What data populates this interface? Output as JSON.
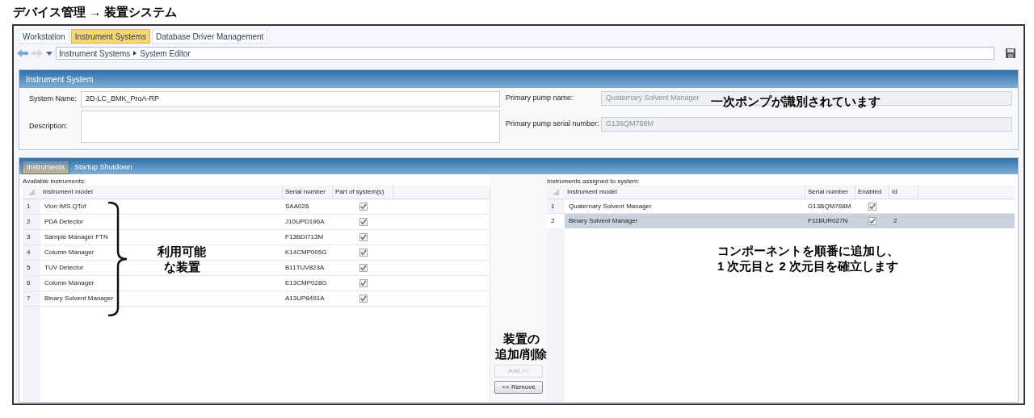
{
  "page_title": "デバイス管理 → 装置システム",
  "tabs": [
    {
      "label": "Workstation",
      "selected": false
    },
    {
      "label": "Instrument Systems",
      "selected": true
    },
    {
      "label": "Database Driver Management",
      "selected": false
    }
  ],
  "breadcrumb": [
    "Instrument Systems",
    "System Editor"
  ],
  "instrument_system": {
    "title": "Instrument System",
    "system_name": {
      "label": "System Name:",
      "value": "2D-LC_BMK_ProA-RP"
    },
    "description": {
      "label": "Description:"
    },
    "primary_pump_name": {
      "label": "Primary pump name:",
      "value": "Quaternary Solvent Manager",
      "disabled": true
    },
    "primary_pump_serial": {
      "label": "Primary pump serial number:",
      "value": "G138QM768M",
      "disabled": true
    }
  },
  "inner_tabs": [
    {
      "label": "Instruments",
      "selected": true
    },
    {
      "label": "Startup Shutdown",
      "selected": false
    }
  ],
  "available": {
    "label": "Available instruments:",
    "columns": [
      "Instrument model",
      "Serial number",
      "Part of system(s)"
    ],
    "rows": [
      {
        "number": "1",
        "model": "Vion IMS QTof",
        "serial": "SAA026",
        "checked": true
      },
      {
        "number": "2",
        "model": "PDA Detector",
        "serial": "J10UPD196A",
        "checked": true
      },
      {
        "number": "3",
        "model": "Sample Manager FTN",
        "serial": "F13BDI713M",
        "checked": true
      },
      {
        "number": "4",
        "model": "Column Manager",
        "serial": "K14CMP005G",
        "checked": true
      },
      {
        "number": "5",
        "model": "TUV Detector",
        "serial": "B11TUV823A",
        "checked": true
      },
      {
        "number": "6",
        "model": "Column Manager",
        "serial": "E13CMP028G",
        "checked": true
      },
      {
        "number": "7",
        "model": "Binary Solvent Manager",
        "serial": "A13UP8491A",
        "checked": true
      }
    ]
  },
  "assigned": {
    "label": "Instruments assigned to system:",
    "columns": [
      "Instrument model",
      "Serial number",
      "Enabled",
      "Id"
    ],
    "rows": [
      {
        "number": "1",
        "model": "Quaternary Solvent Manager",
        "serial": "G13BQM768M",
        "enabled": true,
        "id": "",
        "selected": false
      },
      {
        "number": "2",
        "model": "Binary Solvent Manager",
        "serial": "F11BUR027N",
        "enabled": true,
        "id": "2",
        "selected": true
      }
    ]
  },
  "buttons": [
    {
      "label": "Add >>",
      "disabled": true
    },
    {
      "label": "<< Remove",
      "disabled": false
    }
  ],
  "annotations": {
    "pump": "一次ポンプが識別されています",
    "available": [
      "利用可能",
      "な装置"
    ],
    "order": [
      "コンポーネントを順番に追加し、",
      "1 次元目と 2 次元目を確立します"
    ],
    "buttons": [
      "装置の",
      "追加/削除"
    ]
  }
}
